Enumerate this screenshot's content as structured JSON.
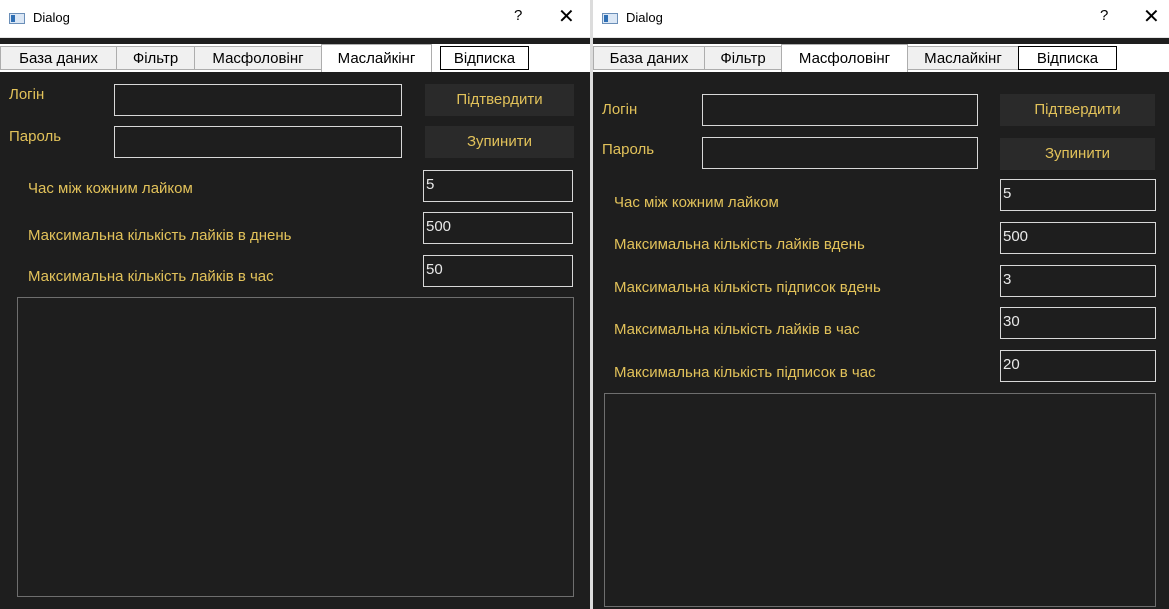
{
  "left": {
    "title": "Dialog",
    "help": "?",
    "close": "✕",
    "tabs": [
      "База даних",
      "Фільтр",
      "Масфоловінг",
      "Маслайкінг",
      "Відписка"
    ],
    "login_label": "Логін",
    "login_value": "",
    "password_label": "Пароль",
    "password_value": "",
    "confirm_button": "Підтвердити",
    "stop_button": "Зупинити",
    "fields": [
      {
        "label": "Час між кожним лайком",
        "value": "5"
      },
      {
        "label": "Максимальна кількість лайків в днень",
        "value": "500"
      },
      {
        "label": "Максимальна кількість лайків в час",
        "value": "50"
      }
    ]
  },
  "right": {
    "title": "Dialog",
    "help": "?",
    "close": "✕",
    "tabs": [
      "База даних",
      "Фільтр",
      "Масфоловінг",
      "Маслайкінг",
      "Відписка"
    ],
    "login_label": "Логін",
    "login_value": "",
    "password_label": "Пароль",
    "password_value": "",
    "confirm_button": "Підтвердити",
    "stop_button": "Зупинити",
    "fields": [
      {
        "label": "Час між кожним лайком",
        "value": "5"
      },
      {
        "label": "Максимальна кількість лайків вдень",
        "value": "500"
      },
      {
        "label": "Максимальна кількість підписок вдень",
        "value": "3"
      },
      {
        "label": "Максимальна кількість лайків в час",
        "value": "30"
      },
      {
        "label": "Максимальна кількість підписок в час",
        "value": "20"
      }
    ]
  },
  "colors": {
    "background": "#1e1e1e",
    "label_text": "#e2c25a",
    "input_border": "#d8d8d8"
  }
}
